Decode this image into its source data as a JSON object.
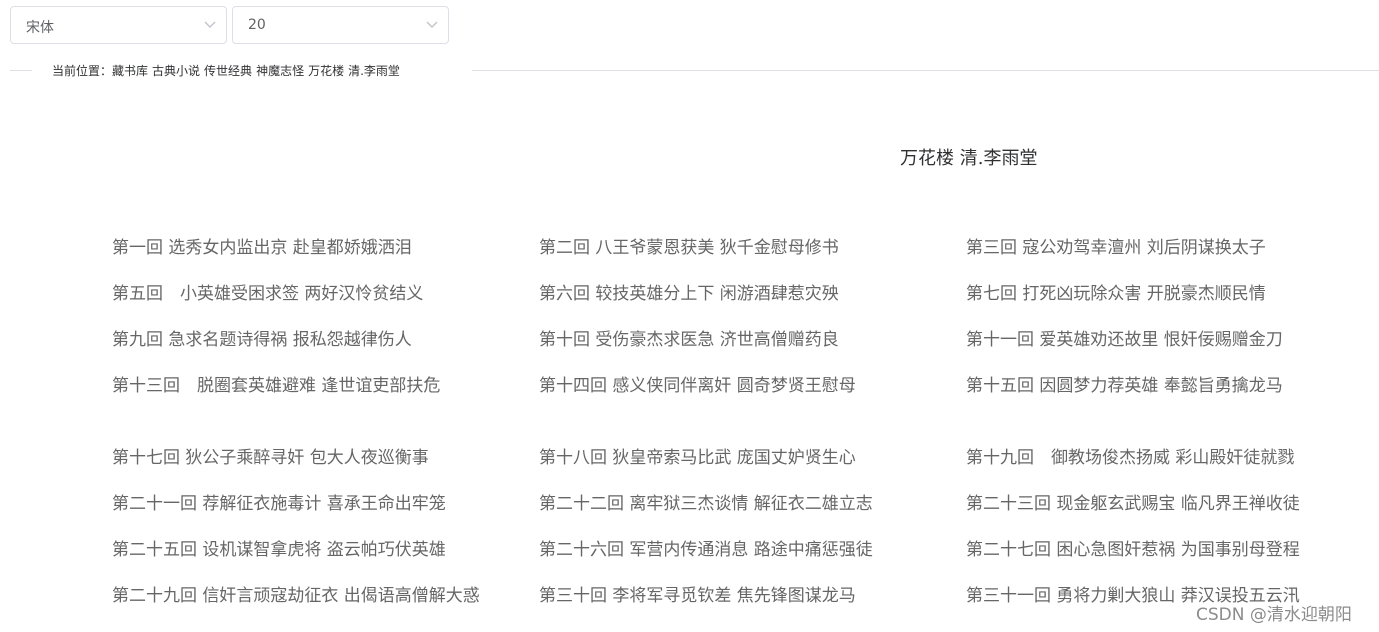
{
  "toolbar": {
    "font_select": {
      "value": "宋体"
    },
    "size_select": {
      "value": "20"
    }
  },
  "breadcrumb": {
    "label": "当前位置：",
    "items": [
      "藏书库",
      "古典小说",
      "传世经典",
      "神魔志怪",
      "万花楼",
      "清.李雨堂"
    ]
  },
  "book_title": "万花楼 清.李雨堂",
  "chapters": [
    "第一回 选秀女内监出京 赴皇都娇娥洒泪",
    "第二回 八王爷蒙恩获美 狄千金慰母修书",
    "第三回 寇公劝驾幸澶州 刘后阴谋换太子",
    "第五回　小英雄受困求签 两好汉怜贫结义",
    "第六回 较技英雄分上下 闲游酒肆惹灾殃",
    "第七回 打死凶玩除众害 开脱豪杰顺民情",
    "第九回 急求名题诗得祸 报私怨越律伤人",
    "第十回 受伤豪杰求医急 济世高僧赠药良",
    "第十一回 爱英雄劝还故里 恨奸佞赐赠金刀",
    "第十三回　脱圈套英雄避难 逢世谊吏部扶危",
    "第十四回 感义侠同伴离奸 圆奇梦贤王慰母",
    "第十五回 因圆梦力荐英雄 奉懿旨勇擒龙马",
    "第十七回 狄公子乘醉寻奸 包大人夜巡衡事",
    "第十八回 狄皇帝索马比武 庞国丈妒贤生心",
    "第十九回　御教场俊杰扬威 彩山殿奸徒就戮",
    "第二十一回 荐解征衣施毒计 喜承王命出牢笼",
    "第二十二回 离牢狱三杰谈情 解征衣二雄立志",
    "第二十三回 现金躯玄武赐宝 临凡界王禅收徒",
    "第二十五回 设机谋智拿虎将 盗云帕巧伏英雄",
    "第二十六回 军营内传通消息 路途中痛惩强徒",
    "第二十七回 困心急图奸惹祸 为国事别母登程",
    "第二十九回 信奸言顽寇劫征衣 出偈语高僧解大惑",
    "第三十回 李将军寻觅钦差 焦先锋图谋龙马",
    "第三十一回 勇将力剿大狼山 莽汉误投五云汛"
  ],
  "watermark": "CSDN @清水迎朝阳"
}
